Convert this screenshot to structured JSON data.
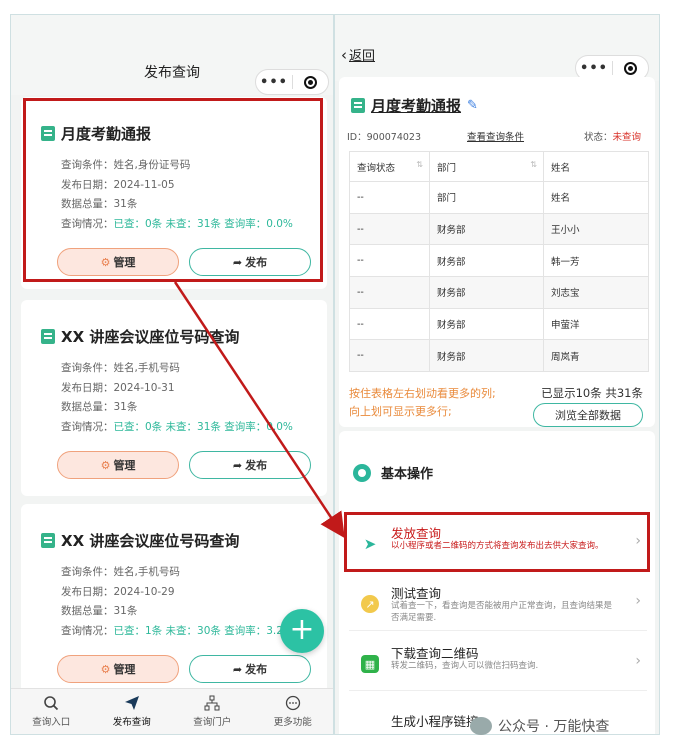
{
  "left": {
    "nav_title": "发布查询",
    "capsule_dots": "•••",
    "cards": [
      {
        "title": "月度考勤通报",
        "condition": "查询条件：姓名,身份证号码",
        "date": "发布日期：2024-11-05",
        "total": "数据总量：31条",
        "status_label": "查询情况：",
        "status_value": "已查：0条 未查：31条 查询率：0.0%",
        "manage": "管理",
        "publish": "发布"
      },
      {
        "title": "XX 讲座会议座位号码查询",
        "condition": "查询条件：姓名,手机号码",
        "date": "发布日期：2024-10-31",
        "total": "数据总量：31条",
        "status_label": "查询情况：",
        "status_value": "已查：0条 未查：31条 查询率：0.0%",
        "manage": "管理",
        "publish": "发布"
      },
      {
        "title": "XX 讲座会议座位号码查询",
        "condition": "查询条件：姓名,手机号码",
        "date": "发布日期：2024-10-29",
        "total": "数据总量：31条",
        "status_label": "查询情况：",
        "status_value": "已查：1条 未查：30条 查询率：3.2%",
        "manage": "管理",
        "publish": "发布"
      }
    ],
    "fab": "+",
    "tabs": [
      {
        "label": "查询入口",
        "icon": "search-icon"
      },
      {
        "label": "发布查询",
        "icon": "send-icon"
      },
      {
        "label": "查询门户",
        "icon": "sitemap-icon"
      },
      {
        "label": "更多功能",
        "icon": "more-icon"
      }
    ]
  },
  "right": {
    "back": "返回",
    "capsule_dots": "•••",
    "title": "月度考勤通报",
    "id_label": "ID：900074023",
    "view_condition": "查看查询条件",
    "state_label": "状态：",
    "state_value": "未查询",
    "table": {
      "headers": [
        "查询状态",
        "部门",
        "姓名"
      ],
      "rows": [
        [
          "--",
          "部门",
          "姓名"
        ],
        [
          "--",
          "财务部",
          "王小小"
        ],
        [
          "--",
          "财务部",
          "韩一芳"
        ],
        [
          "--",
          "财务部",
          "刘志宝"
        ],
        [
          "--",
          "财务部",
          "申萤洋"
        ],
        [
          "--",
          "财务部",
          "周岚青"
        ]
      ]
    },
    "hint1": "按住表格左右划动看更多的列;",
    "hint2": "向上划可显示更多行;",
    "shown": "已显示10条 共31条",
    "browse_all": "浏览全部数据",
    "section_title": "基本操作",
    "ops": [
      {
        "title": "发放查询",
        "desc": "以小程序或者二维码的方式将查询发布出去供大家查询。"
      },
      {
        "title": "测试查询",
        "desc": "试着查一下，看查询是否能被用户正常查询，且查询结果是否满足需要."
      },
      {
        "title": "下载查询二维码",
        "desc": "转发二维码，查询人可以微信扫码查询."
      },
      {
        "title": "生成小程序链接",
        "desc": ""
      }
    ]
  },
  "watermark": "公众号 · 万能快查",
  "colors": {
    "accent": "#2cc2a4",
    "highlight": "#c11a1a",
    "warning": "#e98a3b"
  }
}
